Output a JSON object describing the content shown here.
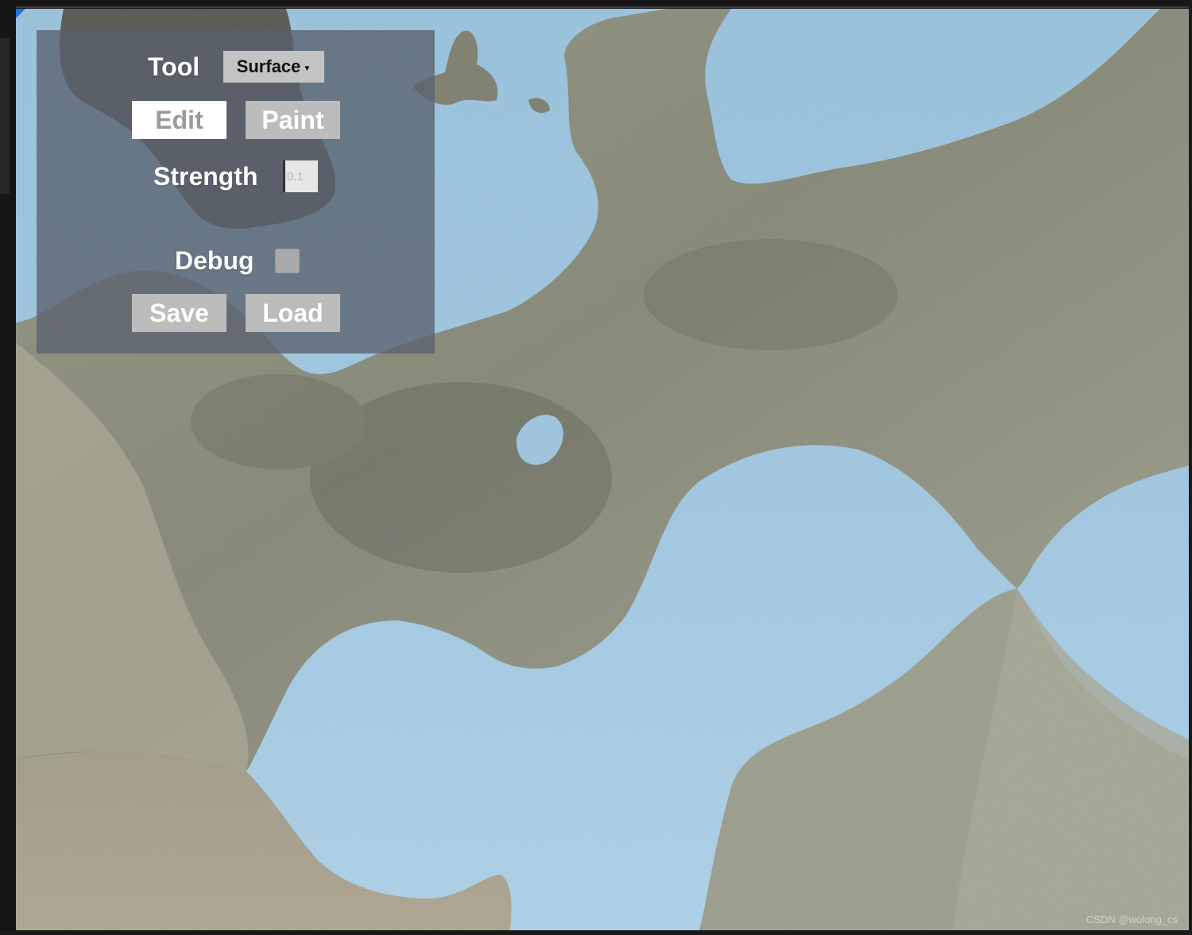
{
  "panel": {
    "tool_label": "Tool",
    "tool_value": "Surface",
    "edit_button": "Edit",
    "paint_button": "Paint",
    "strength_label": "Strength",
    "strength_value": "0.1",
    "debug_label": "Debug",
    "debug_checked": false,
    "save_button": "Save",
    "load_button": "Load"
  },
  "watermark": "CSDN @wolong_cs",
  "icons": [
    "chevron-down-icon"
  ],
  "colors": {
    "sky": "#a6cce6",
    "rock": "#8e907f",
    "panel": "#5a626e",
    "button": "#bcbcbc",
    "selected_button": "#ffffff"
  }
}
